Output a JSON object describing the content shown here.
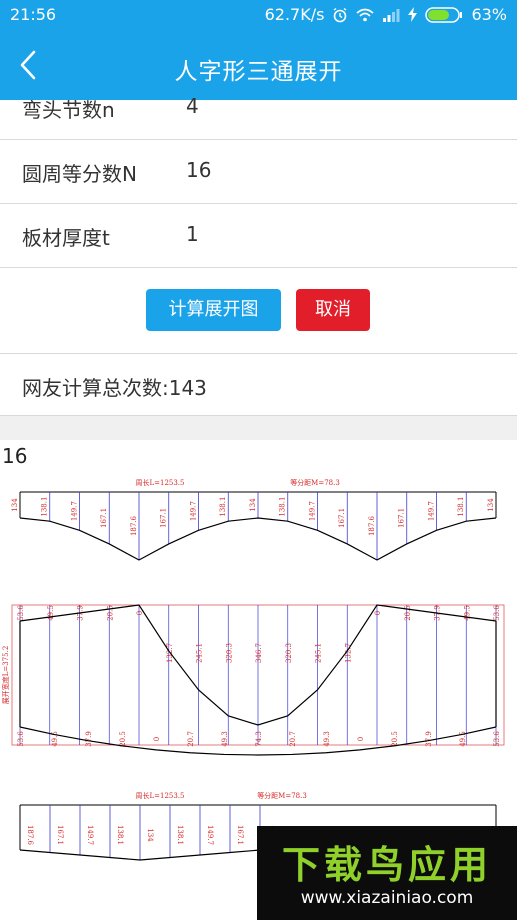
{
  "status": {
    "time": "21:56",
    "speed": "62.7K/s",
    "battery": "63%",
    "icons": [
      "alarm-icon",
      "wifi-icon",
      "signal-icon",
      "charging-icon",
      "battery-icon"
    ]
  },
  "header": {
    "title": "人字形三通展开",
    "back_icon": "chevron-left-icon",
    "background": "#1aa3e8"
  },
  "form": {
    "rows": [
      {
        "label": "弯头节数n",
        "value": "4"
      },
      {
        "label": "圆周等分数N",
        "value": "16"
      },
      {
        "label": "板材厚度t",
        "value": "1"
      }
    ]
  },
  "buttons": {
    "calculate": "计算展开图",
    "cancel": "取消",
    "calculate_color": "#1aa3e8",
    "cancel_color": "#e21e2a"
  },
  "stats": {
    "total_text": "网友计算总次数:143"
  },
  "result": {
    "label": "16"
  },
  "drawing": {
    "top_strip": {
      "perimeter": "周长L=1253.5",
      "spacing": "等分距M=78.3",
      "values": [
        "134",
        "138.1",
        "149.7",
        "167.1",
        "187.6",
        "167.1",
        "149.7",
        "138.1",
        "134",
        "138.1",
        "149.7",
        "167.1",
        "187.6",
        "167.1",
        "149.7",
        "138.1",
        "134"
      ]
    },
    "middle_piece": {
      "side_label": "展开宽度L=375.2",
      "upper_values": [
        "53.6",
        "49.5",
        "37.9",
        "20.5",
        "0",
        "132.7",
        "245.1",
        "320.3",
        "346.7",
        "320.3",
        "245.1",
        "132.7",
        "0",
        "20.5",
        "37.9",
        "49.5",
        "53.6"
      ],
      "lower_values": [
        "53.6",
        "49.5",
        "37.9",
        "20.5",
        "0",
        "20.7",
        "49.3",
        "74.3",
        "20.7",
        "49.3",
        "0",
        "20.5",
        "37.9",
        "49.5",
        "53.6"
      ]
    },
    "bottom_strip": {
      "perimeter": "周长L=1253.5",
      "spacing": "等分距M=78.3",
      "values": [
        "187.6",
        "167.1",
        "149.7",
        "138.1",
        "134",
        "138.1",
        "149.7",
        "167.1",
        "187.6"
      ]
    }
  },
  "watermark": {
    "logo": "下载鸟应用",
    "url": "www.xiazainiao.com"
  }
}
